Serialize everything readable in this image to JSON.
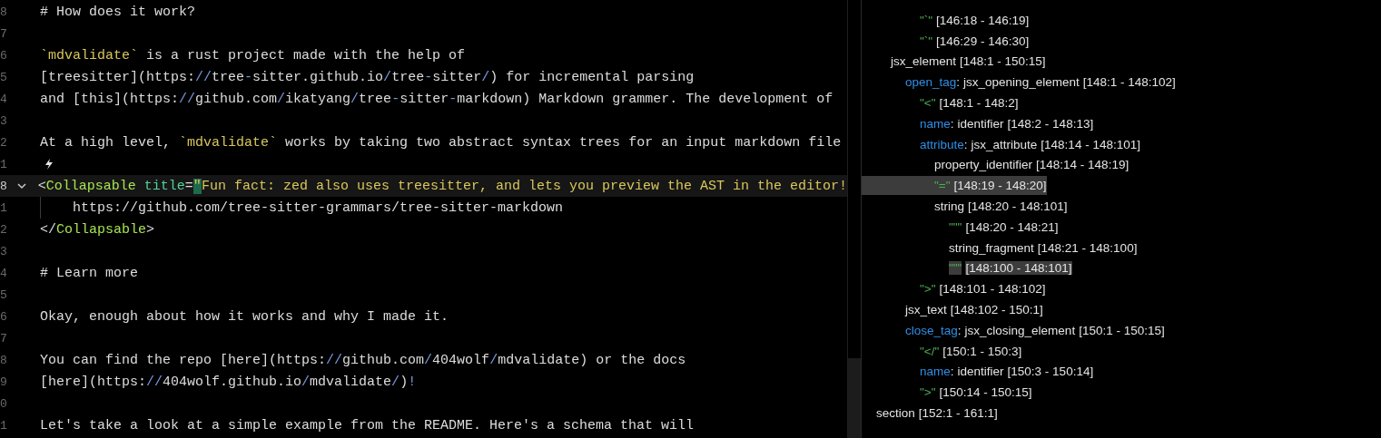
{
  "editor": {
    "lines": [
      {
        "number": "8",
        "segments": [
          {
            "kind": "text",
            "text": "# How does it work?"
          }
        ]
      },
      {
        "number": "7"
      },
      {
        "number": "6",
        "segments": [
          {
            "kind": "code",
            "text": "`mdvalidate`"
          },
          {
            "kind": "text",
            "text": " is a rust project made with the help of"
          }
        ]
      },
      {
        "number": "5",
        "segments": [
          {
            "kind": "text",
            "text": "[treesitter](https:"
          },
          {
            "kind": "slash",
            "text": "//"
          },
          {
            "kind": "text",
            "text": "tree"
          },
          {
            "kind": "slash",
            "text": "-"
          },
          {
            "kind": "text",
            "text": "sitter.github.io"
          },
          {
            "kind": "slash",
            "text": "/"
          },
          {
            "kind": "text",
            "text": "tree"
          },
          {
            "kind": "slash",
            "text": "-"
          },
          {
            "kind": "text",
            "text": "sitter"
          },
          {
            "kind": "slash",
            "text": "/"
          },
          {
            "kind": "text",
            "text": ") for incremental parsing"
          }
        ]
      },
      {
        "number": "4",
        "segments": [
          {
            "kind": "text",
            "text": "and [this](https:"
          },
          {
            "kind": "slash",
            "text": "//"
          },
          {
            "kind": "text",
            "text": "github.com"
          },
          {
            "kind": "slash",
            "text": "/"
          },
          {
            "kind": "text",
            "text": "ikatyang"
          },
          {
            "kind": "slash",
            "text": "/"
          },
          {
            "kind": "text",
            "text": "tree"
          },
          {
            "kind": "slash",
            "text": "-"
          },
          {
            "kind": "text",
            "text": "sitter"
          },
          {
            "kind": "slash",
            "text": "-"
          },
          {
            "kind": "text",
            "text": "markdown) Markdown grammer. The development of "
          }
        ]
      },
      {
        "number": "3"
      },
      {
        "number": "2",
        "segments": [
          {
            "kind": "text",
            "text": "At a high level, "
          },
          {
            "kind": "code",
            "text": "`mdvalidate`"
          },
          {
            "kind": "text",
            "text": " works by taking two abstract syntax trees for an input markdown file"
          }
        ]
      },
      {
        "number": "1",
        "hint": true
      },
      {
        "number": "8",
        "current": true,
        "foldable": true,
        "segments": [
          {
            "kind": "text",
            "text": "<"
          },
          {
            "kind": "tag",
            "text": "Collapsable"
          },
          {
            "kind": "attr",
            "text": " title"
          },
          {
            "kind": "text",
            "text": "="
          },
          {
            "kind": "cursor",
            "text": "\""
          },
          {
            "kind": "string",
            "text": "Fun fact: zed also uses treesitter, and lets you preview the AST in the editor!"
          }
        ]
      },
      {
        "number": "1",
        "guide": true,
        "segments": [
          {
            "kind": "text",
            "text": "    https://github.com/tree-sitter-grammars/tree-sitter-markdown"
          }
        ]
      },
      {
        "number": "2",
        "segments": [
          {
            "kind": "text",
            "text": "</"
          },
          {
            "kind": "tag",
            "text": "Collapsable"
          },
          {
            "kind": "text",
            "text": ">"
          }
        ]
      },
      {
        "number": "3"
      },
      {
        "number": "4",
        "segments": [
          {
            "kind": "text",
            "text": "# Learn more"
          }
        ]
      },
      {
        "number": "5"
      },
      {
        "number": "6",
        "segments": [
          {
            "kind": "text",
            "text": "Okay, enough about how it works and why I made it."
          }
        ]
      },
      {
        "number": "7"
      },
      {
        "number": "8",
        "segments": [
          {
            "kind": "text",
            "text": "You can find the repo [here](https:"
          },
          {
            "kind": "slash",
            "text": "//"
          },
          {
            "kind": "text",
            "text": "github.com"
          },
          {
            "kind": "slash",
            "text": "/"
          },
          {
            "kind": "text",
            "text": "404wolf"
          },
          {
            "kind": "slash",
            "text": "/"
          },
          {
            "kind": "text",
            "text": "mdvalidate) or the docs"
          }
        ]
      },
      {
        "number": "9",
        "segments": [
          {
            "kind": "text",
            "text": "[here](https:"
          },
          {
            "kind": "slash",
            "text": "//"
          },
          {
            "kind": "text",
            "text": "404wolf.github.io"
          },
          {
            "kind": "slash",
            "text": "/"
          },
          {
            "kind": "text",
            "text": "mdvalidate"
          },
          {
            "kind": "slash",
            "text": "/"
          },
          {
            "kind": "text",
            "text": ")"
          },
          {
            "kind": "slash",
            "text": "!"
          }
        ]
      },
      {
        "number": "0"
      },
      {
        "number": "1",
        "segments": [
          {
            "kind": "text",
            "text": "Let's take a look at a simple example from the README. Here's a schema that will"
          }
        ]
      }
    ]
  },
  "syntax_tree": {
    "nodes": [
      {
        "children": [
          {
            "children": [
              {
                "children": [
                  {
                    "kind": "token",
                    "token": "\"`\"",
                    "range": "[146:18 - 146:19]",
                    "selected": false,
                    "hovered": false
                  },
                  {
                    "kind": "token",
                    "token": "\"`\"",
                    "range": "[146:29 - 146:30]",
                    "selected": false,
                    "hovered": false
                  }
                ]
              }
            ]
          },
          {
            "kind": "node",
            "node": "jsx_element",
            "range": "[148:1 - 150:15]",
            "selected": false,
            "hovered": false,
            "children": [
              {
                "kind": "node",
                "field": "open_tag",
                "separator": ":",
                "node": "jsx_opening_element",
                "range": "[148:1 - 148:102]",
                "selected": false,
                "hovered": false,
                "children": [
                  {
                    "kind": "token",
                    "token": "\"<\"",
                    "range": "[148:1 - 148:2]",
                    "selected": false,
                    "hovered": false
                  },
                  {
                    "kind": "node",
                    "field": "name",
                    "separator": ":",
                    "node": "identifier",
                    "range": "[148:2 - 148:13]",
                    "selected": false,
                    "hovered": false
                  },
                  {
                    "kind": "node",
                    "field": "attribute",
                    "separator": ":",
                    "node": "jsx_attribute",
                    "range": "[148:14 - 148:101]",
                    "selected": false,
                    "hovered": false,
                    "children": [
                      {
                        "kind": "node",
                        "node": "property_identifier",
                        "range": "[148:14 - 148:19]",
                        "selected": false,
                        "hovered": false
                      },
                      {
                        "kind": "token",
                        "token": "\"=\"",
                        "range": "[148:19 - 148:20]",
                        "selected": true,
                        "hovered": false
                      },
                      {
                        "kind": "node",
                        "node": "string",
                        "range": "[148:20 - 148:101]",
                        "selected": false,
                        "hovered": false,
                        "children": [
                          {
                            "kind": "token",
                            "token": "\"\"\"",
                            "range": "[148:20 - 148:21]",
                            "selected": false,
                            "hovered": false
                          },
                          {
                            "kind": "node",
                            "node": "string_fragment",
                            "range": "[148:21 - 148:100]",
                            "selected": false,
                            "hovered": false
                          },
                          {
                            "kind": "token",
                            "token": "\"\"\"",
                            "range": "[148:100 - 148:101]",
                            "selected": false,
                            "hovered": true
                          }
                        ]
                      }
                    ]
                  },
                  {
                    "kind": "token",
                    "token": "\">\"",
                    "range": "[148:101 - 148:102]",
                    "selected": false,
                    "hovered": false
                  }
                ]
              },
              {
                "kind": "node",
                "node": "jsx_text",
                "range": "[148:102 - 150:1]",
                "selected": false,
                "hovered": false
              },
              {
                "kind": "node",
                "field": "close_tag",
                "separator": ":",
                "node": "jsx_closing_element",
                "range": "[150:1 - 150:15]",
                "selected": false,
                "hovered": false,
                "children": [
                  {
                    "kind": "token",
                    "token": "\"</\"",
                    "range": "[150:1 - 150:3]",
                    "selected": false,
                    "hovered": false
                  },
                  {
                    "kind": "node",
                    "field": "name",
                    "separator": ":",
                    "node": "identifier",
                    "range": "[150:3 - 150:14]",
                    "selected": false,
                    "hovered": false
                  },
                  {
                    "kind": "token",
                    "token": "\">\"",
                    "range": "[150:14 - 150:15]",
                    "selected": false,
                    "hovered": false
                  }
                ]
              }
            ]
          }
        ]
      },
      {
        "kind": "node",
        "node": "section",
        "range": "[152:1 - 161:1]",
        "selected": false,
        "hovered": false
      }
    ]
  }
}
